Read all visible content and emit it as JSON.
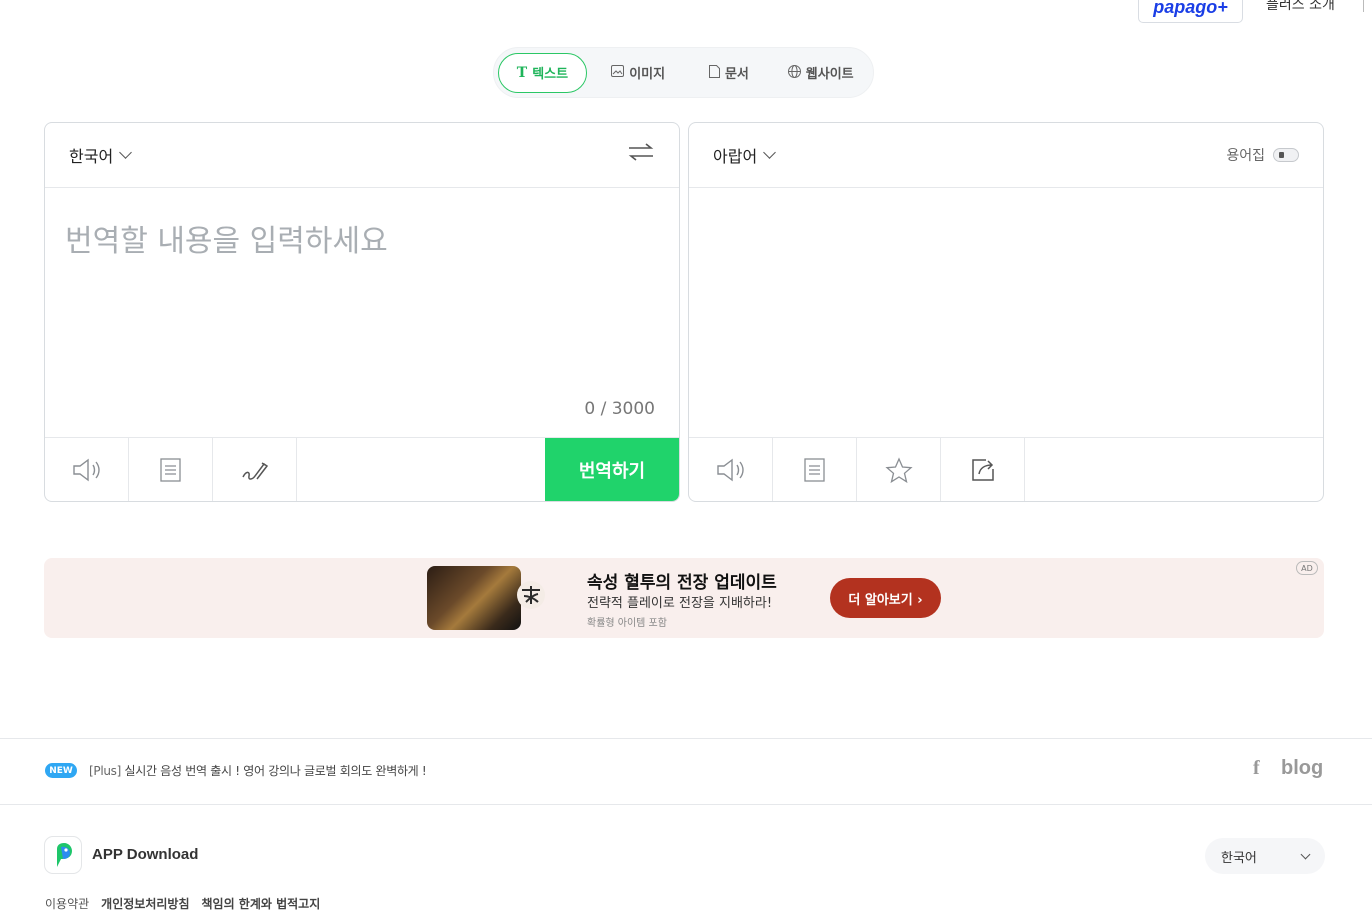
{
  "header": {
    "brand": "papago+",
    "plus_intro": "플러스 소개"
  },
  "tabs": [
    {
      "label": "텍스트",
      "icon": "text-icon",
      "active": true
    },
    {
      "label": "이미지",
      "icon": "image-icon",
      "active": false
    },
    {
      "label": "문서",
      "icon": "document-icon",
      "active": false
    },
    {
      "label": "웹사이트",
      "icon": "globe-icon",
      "active": false
    }
  ],
  "source": {
    "language": "한국어",
    "placeholder": "번역할 내용을 입력하세요",
    "char_count": "0 / 3000",
    "translate_button": "번역하기"
  },
  "target": {
    "language": "아랍어",
    "glossary_label": "용어집"
  },
  "ad": {
    "title": "속성 혈투의 전장 업데이트",
    "subtitle": "전략적 플레이로 전장을 지배하라!",
    "note": "확률형 아이템 포함",
    "cta": "더 알아보기 ›",
    "badge": "AD"
  },
  "notice": {
    "badge": "NEW",
    "tag": "[Plus]",
    "text": "실시간 음성 번역 출시 ! 영어 강의나 글로벌 회의도 완벽하게 !"
  },
  "social": {
    "facebook": "f",
    "blog": "blog"
  },
  "footer": {
    "app_download": "APP Download",
    "language": "한국어",
    "links": [
      "이용약관",
      "개인정보처리방침",
      "책임의 한계와 법적고지"
    ]
  },
  "colors": {
    "accent_green": "#20d36b",
    "brand_blue": "#1a3ee6",
    "ad_cta": "#b3321f",
    "new_badge": "#2fa7f3"
  }
}
